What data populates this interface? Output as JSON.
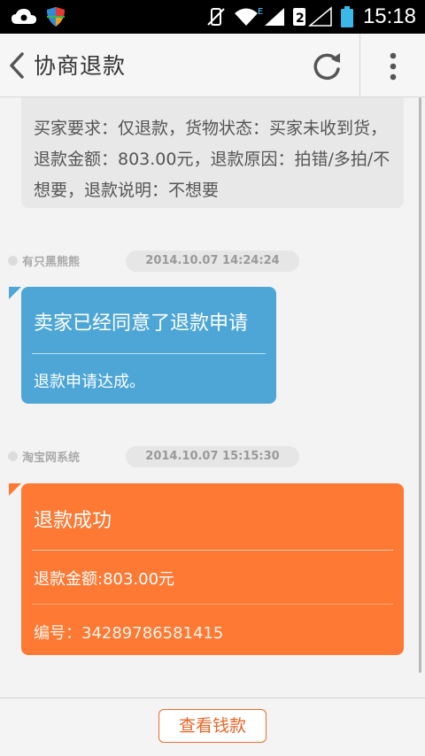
{
  "status_bar": {
    "time": "15:18",
    "icons": [
      "cloud-icon",
      "shield-icon",
      "vibrate-off-icon",
      "wifi-icon",
      "signal-icon",
      "sim2-signal-icon",
      "battery-icon"
    ]
  },
  "header": {
    "title": "协商退款",
    "back_icon": "chevron-left-icon",
    "refresh_icon": "refresh-icon",
    "more_icon": "more-vertical-icon"
  },
  "messages": {
    "buyer_request": {
      "text": "买家要求：仅退款，货物状态：买家未收到货，退款金额：803.00元，退款原因：拍错/多拍/不想要，退款说明：不想要"
    },
    "seller_agree": {
      "sender": "有只黑熊熊",
      "time": "2014.10.07 14:24:24",
      "title": "卖家已经同意了退款申请",
      "body": "退款申请达成。"
    },
    "system_success": {
      "sender": "淘宝网系统",
      "time": "2014.10.07 15:15:30",
      "title": "退款成功",
      "amount": "退款金额:803.00元",
      "number": "编号：34289786581415"
    }
  },
  "footer": {
    "view_money_label": "查看钱款"
  },
  "colors": {
    "blue_bubble": "#4da6d6",
    "orange_bubble": "#fd7934",
    "button_accent": "#e8652a"
  }
}
